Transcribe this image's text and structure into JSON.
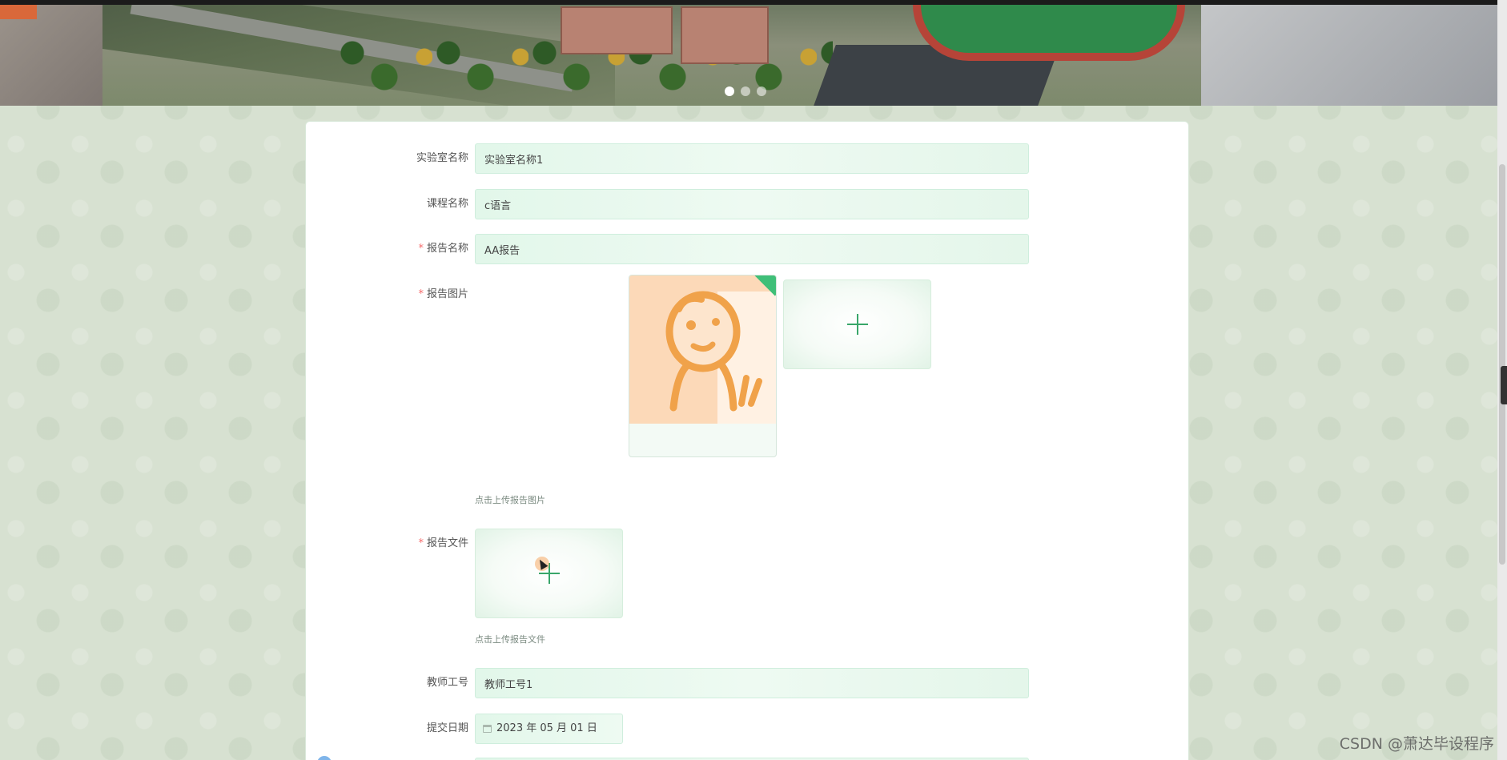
{
  "carousel": {
    "dots": 3,
    "active_index": 0
  },
  "form": {
    "lab_name": {
      "label": "实验室名称",
      "value": "实验室名称1",
      "required": false
    },
    "course_name": {
      "label": "课程名称",
      "value": "c语言",
      "required": false
    },
    "report_name": {
      "label": "报告名称",
      "value": "AA报告",
      "required": true
    },
    "report_image": {
      "label": "报告图片",
      "required": true,
      "hint": "点击上传报告图片"
    },
    "report_file": {
      "label": "报告文件",
      "required": true,
      "hint": "点击上传报告文件"
    },
    "teacher_id": {
      "label": "教师工号",
      "value": "教师工号1",
      "required": false
    },
    "submit_date": {
      "label": "提交日期",
      "value": "2023 年 05 月 01 日",
      "required": false
    }
  },
  "required_mark": "*",
  "watermark": "CSDN @萧达毕设程序",
  "colors": {
    "accent": "#39a66a",
    "required": "#f56c6c",
    "input_bg": "#e2f7ea"
  }
}
